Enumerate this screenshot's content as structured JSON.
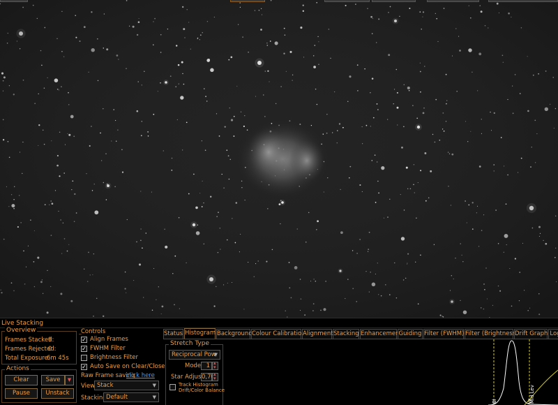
{
  "panel": {
    "title": "Live Stacking"
  },
  "overview": {
    "legend": "Overview",
    "frames_stacked_label": "Frames Stacked:",
    "frames_stacked": "9",
    "frames_rejected_label": "Frames Rejected:",
    "frames_rejected": "0",
    "total_exposure_label": "Total Exposure:",
    "total_exposure": "6m 45s"
  },
  "actions": {
    "legend": "Actions",
    "clear": "Clear",
    "save": "Save",
    "pause": "Pause",
    "unstack": "Unstack"
  },
  "controls": {
    "legend": "Controls",
    "align_frames": "Align Frames",
    "fwhm_filter": "FWHM Filter",
    "brightness_filter": "Brightness Filter",
    "auto_save": "Auto Save on Clear/Close",
    "raw_saving_label": "Raw Frame saving",
    "raw_saving_link": "click here",
    "view_label": "View",
    "view_value": "Stack",
    "stacking_label": "Stacking",
    "stacking_value": "Default"
  },
  "tabs": [
    "Status",
    "Histogram",
    "Background",
    "Colour Calibration",
    "Alignment",
    "Stacking",
    "Enhancement",
    "Guiding",
    "Filter (FWHM)",
    "Filter (Brightness)",
    "Drift Graph",
    "Log"
  ],
  "histogram": {
    "legend": "Stretch Type",
    "stretch_value": "Reciprocal Pow",
    "mode_label": "Mode",
    "mode_value": "1",
    "star_adjust_label": "Star Adjust",
    "star_adjust_value": "0,70",
    "track_line1": "Track Histogram",
    "track_line2": "Drift/Color Balance",
    "marker_left": "Bl",
    "marker_mid": "Mid Lev",
    "marker_right": "W"
  },
  "colors": {
    "accent": "#f0a040",
    "link": "#3aa0ff",
    "curve_yellow": "#d8d020"
  }
}
